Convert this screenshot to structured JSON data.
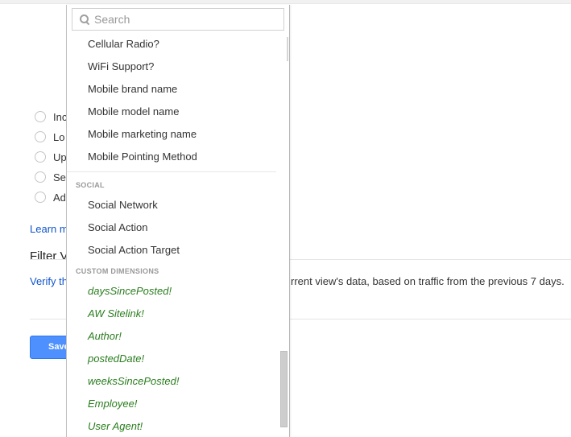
{
  "background": {
    "radio_options": [
      {
        "label": "Inc"
      },
      {
        "label": "Lo"
      },
      {
        "label": "Up"
      },
      {
        "label": "Se"
      },
      {
        "label": "Ad"
      }
    ],
    "learn_more_link": "Learn m",
    "filter_verification_title": "Filter V",
    "verify_link": "Verify th",
    "verify_description": "rrent view's data, based on traffic from the previous 7 days.",
    "save_button": "Save"
  },
  "dropdown": {
    "search": {
      "placeholder": "Search",
      "value": ""
    },
    "items_top": [
      {
        "label": "Cellular Radio?"
      },
      {
        "label": "WiFi Support?"
      },
      {
        "label": "Mobile brand name"
      },
      {
        "label": "Mobile model name"
      },
      {
        "label": "Mobile marketing name"
      },
      {
        "label": "Mobile Pointing Method"
      }
    ],
    "sections": [
      {
        "title": "SOCIAL",
        "items": [
          {
            "label": "Social Network"
          },
          {
            "label": "Social Action"
          },
          {
            "label": "Social Action Target"
          }
        ]
      },
      {
        "title": "CUSTOM DIMENSIONS",
        "items": [
          {
            "label": "daysSincePosted!"
          },
          {
            "label": "AW Sitelink!"
          },
          {
            "label": "Author!"
          },
          {
            "label": "postedDate!"
          },
          {
            "label": "weeksSincePosted!"
          },
          {
            "label": "Employee!"
          },
          {
            "label": "User Agent!"
          }
        ]
      }
    ],
    "colors": {
      "custom_dimension_text": "#2a7d1e",
      "link": "#1155cc",
      "primary_button": "#4d90fe"
    }
  }
}
